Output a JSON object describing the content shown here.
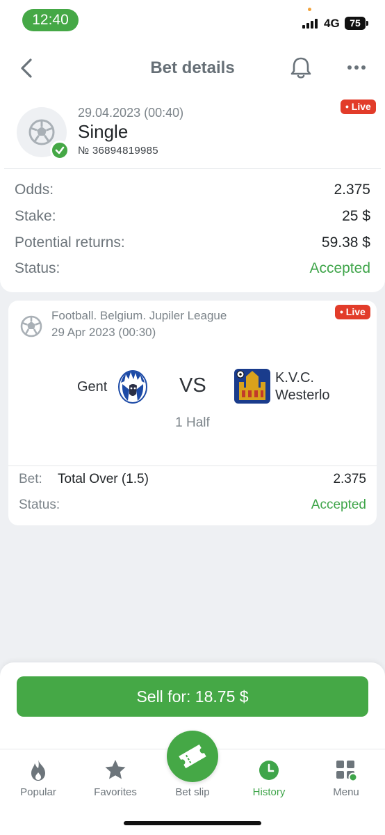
{
  "status_bar": {
    "time": "12:40",
    "network": "4G",
    "battery": "75"
  },
  "header": {
    "title": "Bet details"
  },
  "summary": {
    "date": "29.04.2023 (00:40)",
    "type": "Single",
    "number": "№ 36894819985",
    "live_badge": "• Live",
    "rows": [
      {
        "label": "Odds:",
        "value": "2.375"
      },
      {
        "label": "Stake:",
        "value": "25 $"
      },
      {
        "label": "Potential returns:",
        "value": "59.38 $"
      },
      {
        "label": "Status:",
        "value": "Accepted"
      }
    ]
  },
  "event": {
    "league": "Football. Belgium. Jupiler League",
    "date": "29 Apr 2023 (00:30)",
    "live_badge": "• Live",
    "home_team": "Gent",
    "vs": "VS",
    "away_team_line1": "K.V.C.",
    "away_team_line2": "Westerlo",
    "period": "1 Half",
    "bet_label": "Bet:",
    "bet_text": "Total Over (1.5)",
    "bet_odds": "2.375",
    "status_label": "Status:",
    "status_value": "Accepted"
  },
  "sell_button": {
    "label": "Sell for: 18.75 $"
  },
  "bottom_nav": [
    {
      "label": "Popular",
      "icon": "flame-icon"
    },
    {
      "label": "Favorites",
      "icon": "star-icon"
    },
    {
      "label": "Bet slip",
      "icon": "ticket-icon"
    },
    {
      "label": "History",
      "icon": "clock-icon",
      "active": true
    },
    {
      "label": "Menu",
      "icon": "grid-icon"
    }
  ],
  "colors": {
    "accent": "#45a846",
    "live": "#e23c2a",
    "status_accepted": "#3fa54a"
  }
}
